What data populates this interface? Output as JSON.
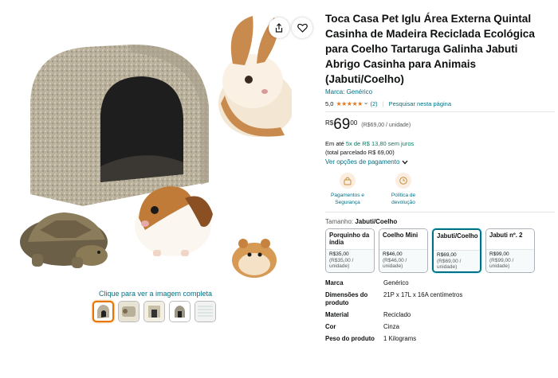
{
  "gallery": {
    "see_full_image": "Clique para ver a imagem completa",
    "thumbnails": [
      "thumb-1",
      "thumb-2",
      "thumb-3",
      "thumb-4",
      "thumb-5"
    ],
    "share_icon": "share-icon",
    "wishlist_icon": "heart-icon"
  },
  "product": {
    "title": "Toca Casa Pet Iglu Área Externa Quintal Casinha de Madeira Reciclada Ecológica para Coelho Tartaruga Galinha Jabuti Abrigo Casinha para Animais (Jabuti/Coelho)",
    "brand_link": "Marca: Genérico",
    "rating_value": "5,0",
    "stars": "★★★★★",
    "chevron": "⌄",
    "rating_count": "(2)",
    "separator": "|",
    "search_link": "Pesquisar nesta página"
  },
  "price": {
    "symbol": "R$",
    "integer": "69",
    "cents": "00",
    "unit": "(R$69,00 / unidade)",
    "installment_prefix": "Em até ",
    "installment_highlight": "5x de R$ 13,80 sem juros",
    "total": "(total parcelado R$ 69,00)",
    "payment_options": "Ver opções de pagamento"
  },
  "features": [
    {
      "label": "Pagamentos e Segurança",
      "icon": "lock-icon"
    },
    {
      "label": "Política de devolução",
      "icon": "return-icon"
    }
  ],
  "size": {
    "label": "Tamanho: ",
    "selected": "Jabuti/Coelho",
    "variants": [
      {
        "name": "Porquinho da índia",
        "price": "R$35,00",
        "old": "(R$35,00 / unidade)"
      },
      {
        "name": "Coelho Mini",
        "price": "R$46,00",
        "old": "(R$46,00 / unidade)"
      },
      {
        "name": "Jabuti/Coelho",
        "price": "R$69,00",
        "old": "(R$69,00 / unidade)"
      },
      {
        "name": "Jabuti nº. 2",
        "price": "R$99,00",
        "old": "(R$99,00 / unidade)"
      }
    ]
  },
  "specs": [
    {
      "key": "Marca",
      "value": "Genérico"
    },
    {
      "key": "Dimensões do produto",
      "value": "21P x 17L x 16A centímetros"
    },
    {
      "key": "Material",
      "value": "Reciclado"
    },
    {
      "key": "Cor",
      "value": "Cinza"
    },
    {
      "key": "Peso do produto",
      "value": "1 Kilograms"
    }
  ],
  "colors": {
    "link": "#007185",
    "star": "#de7921",
    "green": "#067d62",
    "selected_border": "#007185"
  }
}
